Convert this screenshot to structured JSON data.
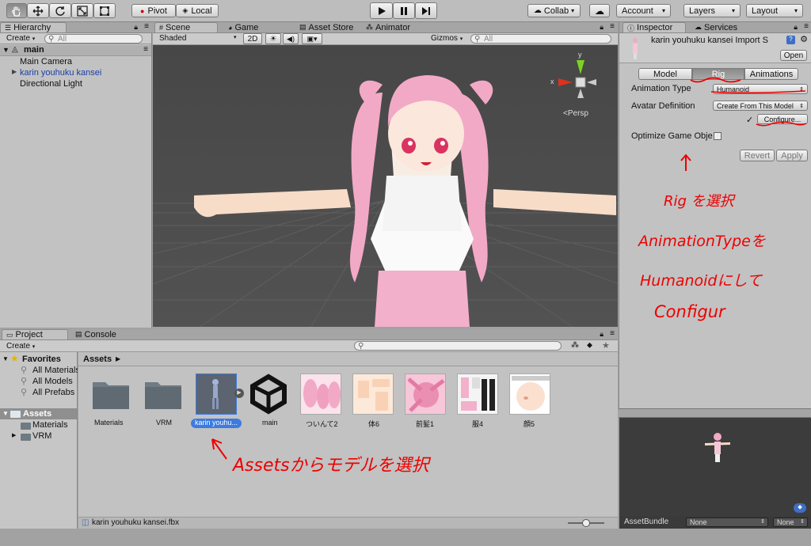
{
  "toolbar": {
    "tools": [
      "hand-icon",
      "move-icon",
      "rotate-icon",
      "scale-icon",
      "rect-icon"
    ],
    "pivot": "Pivot",
    "local": "Local",
    "play": "play-icon",
    "pause": "pause-icon",
    "step": "step-icon",
    "collab": "Collab",
    "account": "Account",
    "layers": "Layers",
    "layout": "Layout"
  },
  "hierarchy": {
    "tab": "Hierarchy",
    "create": "Create",
    "search_placeholder": "All",
    "scene": "main",
    "items": [
      "Main Camera",
      "karin youhuku kansei",
      "Directional Light"
    ]
  },
  "scene_view": {
    "tabs": [
      "Scene",
      "Game",
      "Asset Store",
      "Animator"
    ],
    "shading": "Shaded",
    "mode2d": "2D",
    "gizmos": "Gizmos",
    "search_placeholder": "All",
    "persp": "Persp",
    "axis_x": "x",
    "axis_y": "y"
  },
  "inspector": {
    "tabs": [
      "Inspector",
      "Services"
    ],
    "title": "karin youhuku kansei Import S",
    "open": "Open",
    "rig_tabs": [
      "Model",
      "Rig",
      "Animations"
    ],
    "animation_type_label": "Animation Type",
    "animation_type": "Humanoid",
    "avatar_def_label": "Avatar Definition",
    "avatar_def": "Create From This Model",
    "check": "✓",
    "configure": "Configure...",
    "optimize_label": "Optimize Game Obje",
    "revert": "Revert",
    "apply": "Apply",
    "asset_bundle_label": "AssetBundle",
    "bundle_none": "None",
    "variant_none": "None"
  },
  "project": {
    "tabs": [
      "Project",
      "Console"
    ],
    "create": "Create",
    "favorites": "Favorites",
    "fav_items": [
      "All Materials",
      "All Models",
      "All Prefabs"
    ],
    "assets": "Assets",
    "asset_folders": [
      "Materials",
      "VRM"
    ],
    "breadcrumb": "Assets",
    "items": [
      "Materials",
      "VRM",
      "karin youhu...",
      "main",
      "ついんて2",
      "体6",
      "前髪1",
      "服4",
      "顔5"
    ],
    "footer_file": "karin youhuku kansei.fbx",
    "zoom_level": 0.5
  },
  "annotations": {
    "rig_select": "Rig を選択",
    "anim_line1": "AnimationTypeを",
    "anim_line2": "Humanoidにして",
    "anim_line3": "Configur",
    "assets_select": "Assetsからモデルを選択"
  },
  "colors": {
    "selection": "#3d7be0",
    "annotation": "#ee0000",
    "scene_bg": "#4a4a4a",
    "hair": "#f2a9c6"
  }
}
